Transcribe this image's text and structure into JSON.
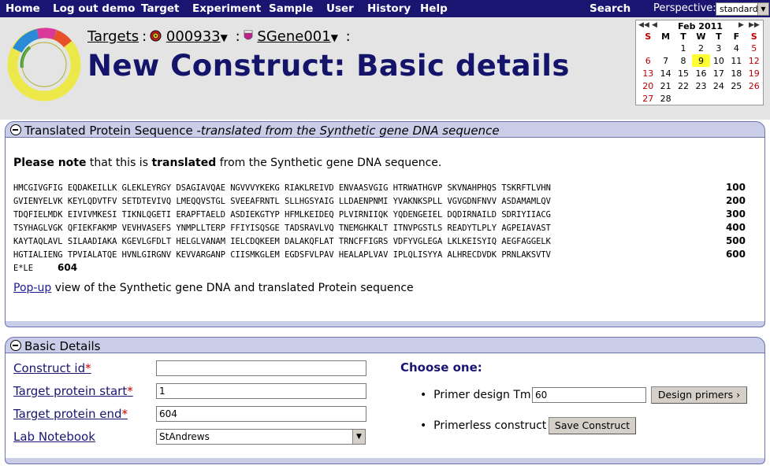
{
  "nav": {
    "items": [
      "Home",
      "Log out demo",
      "Target",
      "Experiment",
      "Sample",
      "User",
      "History",
      "Help"
    ],
    "search": "Search",
    "perspective_label": "Perspective:",
    "perspective_value": "standard"
  },
  "breadcrumb": {
    "targets": "Targets",
    "target_id": "000933",
    "gene": "SGene001"
  },
  "page_title": "New Construct: Basic details",
  "calendar": {
    "month": "Feb 2011",
    "day_headers": [
      "S",
      "M",
      "T",
      "W",
      "T",
      "F",
      "S"
    ],
    "weeks": [
      [
        "",
        "",
        "1",
        "2",
        "3",
        "4",
        "5"
      ],
      [
        "6",
        "7",
        "8",
        "9",
        "10",
        "11",
        "12"
      ],
      [
        "13",
        "14",
        "15",
        "16",
        "17",
        "18",
        "19"
      ],
      [
        "20",
        "21",
        "22",
        "23",
        "24",
        "25",
        "26"
      ],
      [
        "27",
        "28",
        "",
        "",
        "",
        "",
        ""
      ]
    ],
    "today": "9"
  },
  "protein_panel": {
    "title": "Translated Protein Sequence",
    "subtitle": " -translated from the Synthetic gene DNA sequence",
    "note_bold1": "Please note",
    "note_mid": " that this is ",
    "note_bold2": "translated",
    "note_end": " from the Synthetic gene DNA sequence.",
    "sequence_lines": [
      {
        "seq": "HMCGIVGFIG EQDAKEILLK GLEKLEYRGY DSAGIAVQAE NGVVVYKEKG RIAKLREIVD ENVAASVGIG HTRWATHGVP SKVNAHPHQS TSKRFTLVHN",
        "num": "100"
      },
      {
        "seq": "GVIENYELVK KEYLQDVTFV SETDTEVIVQ LMEQQVSTGL SVEEAFRNTL SLLHGSYAIG LLDAENPNMI YVAKNKSPLL VGVGDNFNVV ASDAMAMLQV",
        "num": "200"
      },
      {
        "seq": "TDQFIELMDK EIVIVMKESI TIKNLQGETI ERAPFTAELD ASDIEKGTYP HFMLKEIDEQ PLVIRNIIQK YQDENGEIEL DQDIRNAILD SDRIYIIACG",
        "num": "300"
      },
      {
        "seq": "TSYHAGLVGK QFIEKFAKMP VEVHVASEFS YNMPLLTERP FFIYISQSGE TADSRAVLVQ TNEMGHKALT ITNVPGSTLS READYTLPLY AGPEIAVAST",
        "num": "400"
      },
      {
        "seq": "KAYTAQLAVL SILAADIAKA KGEVLGFDLT HELGLVANAM IELCDQKEEM DALAKQFLAT TRNCFFIGRS VDFYVGLEGA LKLKEISYIQ AEGFAGGELK",
        "num": "500"
      },
      {
        "seq": "HGTIALIENG TPVIALATQE HVNLGIRGNV KEVVARGANP CIISMKGLEM EGDSFVLPAV HEALAPLVAV IPLQLISYYA ALHRECDVDK PRNLAKSVTV",
        "num": "600"
      }
    ],
    "last_seq": "E*LE",
    "last_num": "604",
    "popup_link": "Pop-up",
    "popup_rest": " view of the Synthetic gene DNA and translated Protein sequence"
  },
  "basic_panel": {
    "title": "Basic Details",
    "fields": {
      "construct_id": {
        "label": "Construct id",
        "value": ""
      },
      "start": {
        "label": "Target protein start",
        "value": "1"
      },
      "end": {
        "label": "Target protein end",
        "value": "604"
      },
      "notebook": {
        "label": "Lab Notebook",
        "value": "StAndrews"
      }
    },
    "required_mark": "*",
    "choose_one": "Choose one:",
    "primer_label": "Primer design Tm",
    "primer_value": "60",
    "design_button": "Design primers ›",
    "primerless_label": "Primerless construct",
    "save_button": "Save Construct"
  }
}
